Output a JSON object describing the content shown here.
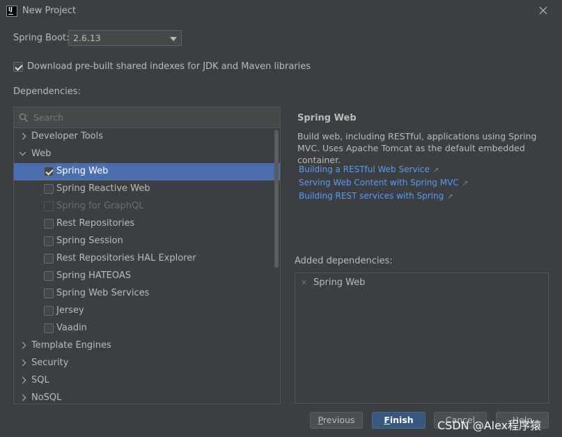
{
  "window": {
    "title": "New Project"
  },
  "spring_boot": {
    "label": "Spring Boot:",
    "value": "2.6.13"
  },
  "download_indexes": {
    "label": "Download pre-built shared indexes for JDK and Maven libraries",
    "checked": true
  },
  "dependencies": {
    "label": "Dependencies:",
    "search_placeholder": "Search",
    "tree": {
      "developer_tools": "Developer Tools",
      "web": "Web",
      "web_children": [
        {
          "label": "Spring Web",
          "checked": true,
          "selected": true
        },
        {
          "label": "Spring Reactive Web",
          "checked": false
        },
        {
          "label": "Spring for GraphQL",
          "checked": false,
          "disabled": true
        },
        {
          "label": "Rest Repositories",
          "checked": false
        },
        {
          "label": "Spring Session",
          "checked": false
        },
        {
          "label": "Rest Repositories HAL Explorer",
          "checked": false
        },
        {
          "label": "Spring HATEOAS",
          "checked": false
        },
        {
          "label": "Spring Web Services",
          "checked": false
        },
        {
          "label": "Jersey",
          "checked": false
        },
        {
          "label": "Vaadin",
          "checked": false
        }
      ],
      "template_engines": "Template Engines",
      "security": "Security",
      "sql": "SQL",
      "nosql": "NoSQL"
    }
  },
  "details": {
    "title": "Spring Web",
    "description": "Build web, including RESTful, applications using Spring MVC. Uses Apache Tomcat as the default embedded container.",
    "links": [
      "Building a RESTful Web Service",
      "Serving Web Content with Spring MVC",
      "Building REST services with Spring"
    ]
  },
  "added": {
    "label": "Added dependencies:",
    "items": [
      "Spring Web"
    ]
  },
  "buttons": {
    "previous": "Previous",
    "finish": "Finish",
    "cancel": "Cancel",
    "help": "Help"
  },
  "watermark": "CSDN @Alex程序猿",
  "colors": {
    "background": "#3c3f41",
    "selection": "#4b6eaf",
    "link": "#589df6",
    "default_button": "#365880"
  }
}
